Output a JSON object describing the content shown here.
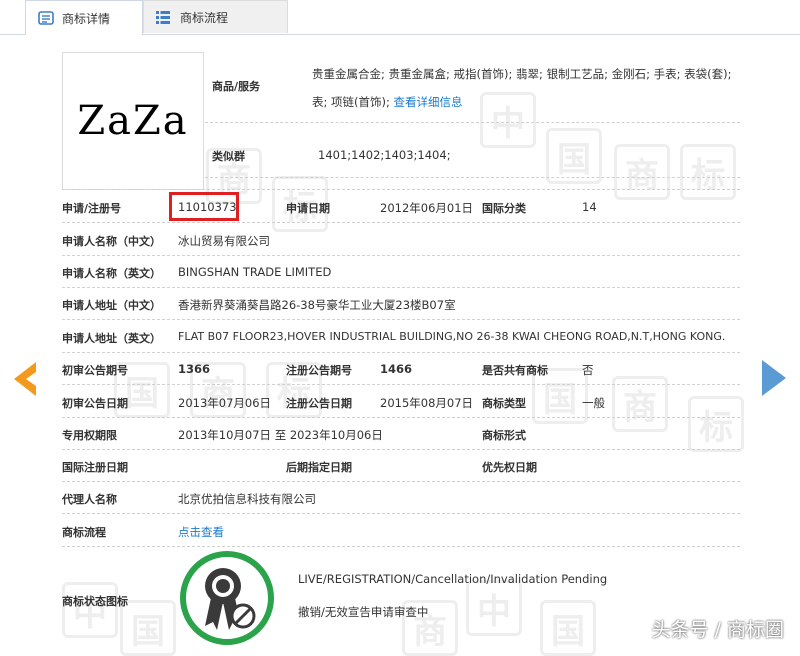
{
  "tabs": [
    {
      "label": "商标详情"
    },
    {
      "label": "商标流程"
    }
  ],
  "logo": {
    "text": "ZaZa"
  },
  "goods": {
    "label": "商品/服务",
    "text": "贵重金属合金; 贵重金属盒; 戒指(首饰); 翡翠; 银制工艺品; 金刚石; 手表; 表袋(套); 表; 项链(首饰); ",
    "link": "查看详细信息"
  },
  "similar": {
    "label": "类似群",
    "value": "1401;1402;1403;1404;"
  },
  "rows": {
    "reg_no": {
      "label": "申请/注册号",
      "value": "11010373"
    },
    "apply_date": {
      "label": "申请日期",
      "value": "2012年06月01日"
    },
    "intl_class": {
      "label": "国际分类",
      "value": "14"
    },
    "name_cn": {
      "label": "申请人名称（中文）",
      "value": "冰山贸易有限公司"
    },
    "name_en": {
      "label": "申请人名称（英文）",
      "value": "BINGSHAN TRADE LIMITED"
    },
    "addr_cn": {
      "label": "申请人地址（中文）",
      "value": "香港新界葵涌葵昌路26-38号豪华工业大厦23楼B07室"
    },
    "addr_en": {
      "label": "申请人地址（英文）",
      "value": "FLAT B07 FLOOR23,HOVER INDUSTRIAL BUILDING,NO 26-38 KWAI CHEONG ROAD,N.T,HONG KONG."
    },
    "prelim_no": {
      "label": "初审公告期号",
      "value": "1366"
    },
    "reg_pub_no": {
      "label": "注册公告期号",
      "value": "1466"
    },
    "shared": {
      "label": "是否共有商标",
      "value": "否"
    },
    "prelim_date": {
      "label": "初审公告日期",
      "value": "2013年07月06日"
    },
    "reg_pub_date": {
      "label": "注册公告日期",
      "value": "2015年08月07日"
    },
    "tm_type": {
      "label": "商标类型",
      "value": "一般"
    },
    "exclusive": {
      "label": "专用权期限",
      "value": "2013年10月07日 至 2023年10月06日"
    },
    "tm_form": {
      "label": "商标形式",
      "value": ""
    },
    "intl_reg_date": {
      "label": "国际注册日期",
      "value": ""
    },
    "later_date": {
      "label": "后期指定日期",
      "value": ""
    },
    "priority_date": {
      "label": "优先权日期",
      "value": ""
    },
    "agent": {
      "label": "代理人名称",
      "value": "北京优拍信息科技有限公司"
    },
    "flow": {
      "label": "商标流程",
      "value": "点击查看"
    },
    "status": {
      "label": "商标状态图标",
      "line1": "LIVE/REGISTRATION/Cancellation/Invalidation Pending",
      "line2": "撤销/无效宣告申请审查中"
    }
  },
  "watermark": {
    "chars": [
      "中",
      "国",
      "商",
      "标"
    ]
  },
  "footer": {
    "text": "头条号 / 商标圈"
  },
  "colors": {
    "accent": "#1a7bd0",
    "highlight": "#e02020",
    "arrow_left": "#f39a1e",
    "arrow_right": "#5b9bd5",
    "status_ring": "#2aa34a"
  }
}
